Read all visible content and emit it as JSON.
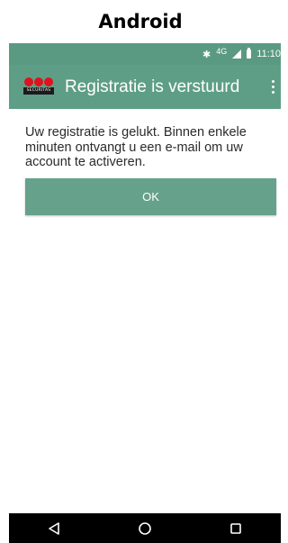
{
  "caption": "Android",
  "status_bar": {
    "bluetooth_icon": "bluetooth-icon",
    "network": "4G",
    "time": "11:10"
  },
  "app_bar": {
    "logo_text": "SECURITAS",
    "title": "Registratie is verstuurd",
    "accent": "#5f9e86"
  },
  "content": {
    "message": "Uw registratie is gelukt. Binnen enkele minuten ontvangt u een e-mail om uw account te activeren.",
    "ok_label": "OK",
    "button_color": "#66a18b"
  },
  "nav_bar": {
    "back_icon": "back-triangle-icon",
    "home_icon": "home-circle-icon",
    "recents_icon": "recents-square-icon"
  }
}
